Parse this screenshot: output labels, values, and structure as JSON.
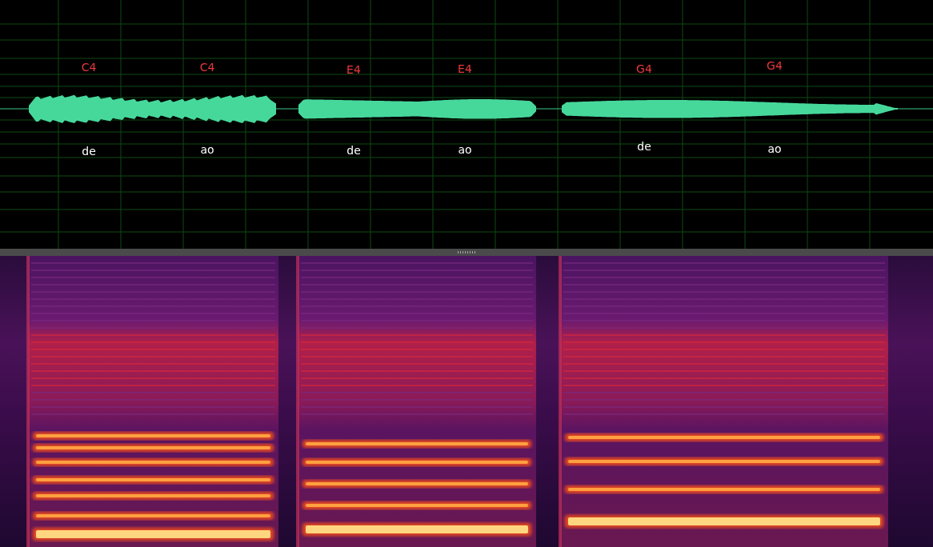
{
  "notes": [
    {
      "pitch": "C4",
      "lyric": "de"
    },
    {
      "pitch": "C4",
      "lyric": "ao"
    },
    {
      "pitch": "E4",
      "lyric": "de"
    },
    {
      "pitch": "E4",
      "lyric": "ao"
    },
    {
      "pitch": "G4",
      "lyric": "de"
    },
    {
      "pitch": "G4",
      "lyric": "ao"
    }
  ]
}
